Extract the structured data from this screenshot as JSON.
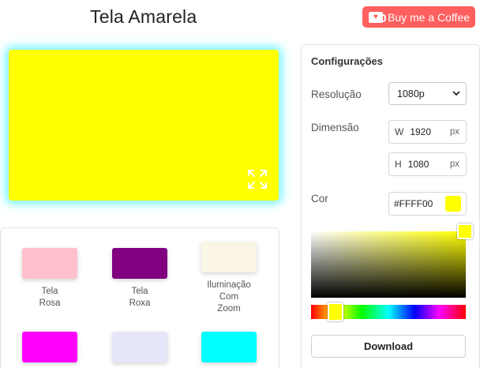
{
  "header": {
    "title": "Tela Amarela",
    "coffee_label": "Buy me a Coffee"
  },
  "preview": {
    "color": "#FFFF00",
    "icon": "fullscreen-icon"
  },
  "presets": [
    {
      "label_line1": "Tela",
      "label_line2": "Rosa",
      "label_line3": "",
      "color": "#FFC0CB"
    },
    {
      "label_line1": "Tela",
      "label_line2": "Roxa",
      "label_line3": "",
      "color": "#800080"
    },
    {
      "label_line1": "Iluminação",
      "label_line2": "Com",
      "label_line3": "Zoom",
      "color": "#FAF5E4"
    },
    {
      "label_line1": "",
      "label_line2": "",
      "label_line3": "",
      "color": "#FF00FF"
    },
    {
      "label_line1": "",
      "label_line2": "",
      "label_line3": "",
      "color": "#E6E6FA"
    },
    {
      "label_line1": "",
      "label_line2": "",
      "label_line3": "",
      "color": "#00FFFF"
    }
  ],
  "config": {
    "title": "Configurações",
    "resolution_label": "Resolução",
    "resolution_value": "1080p",
    "dimension_label": "Dimensão",
    "width_prefix": "W",
    "width_value": "1920",
    "height_prefix": "H",
    "height_value": "1080",
    "unit": "px",
    "color_label": "Cor",
    "color_value": "#FFFF00",
    "download_label": "Download"
  },
  "colors": {
    "accent_coffee": "#FF5F5F",
    "selected": "#FFFF00",
    "glow": "#6FF5FF"
  }
}
